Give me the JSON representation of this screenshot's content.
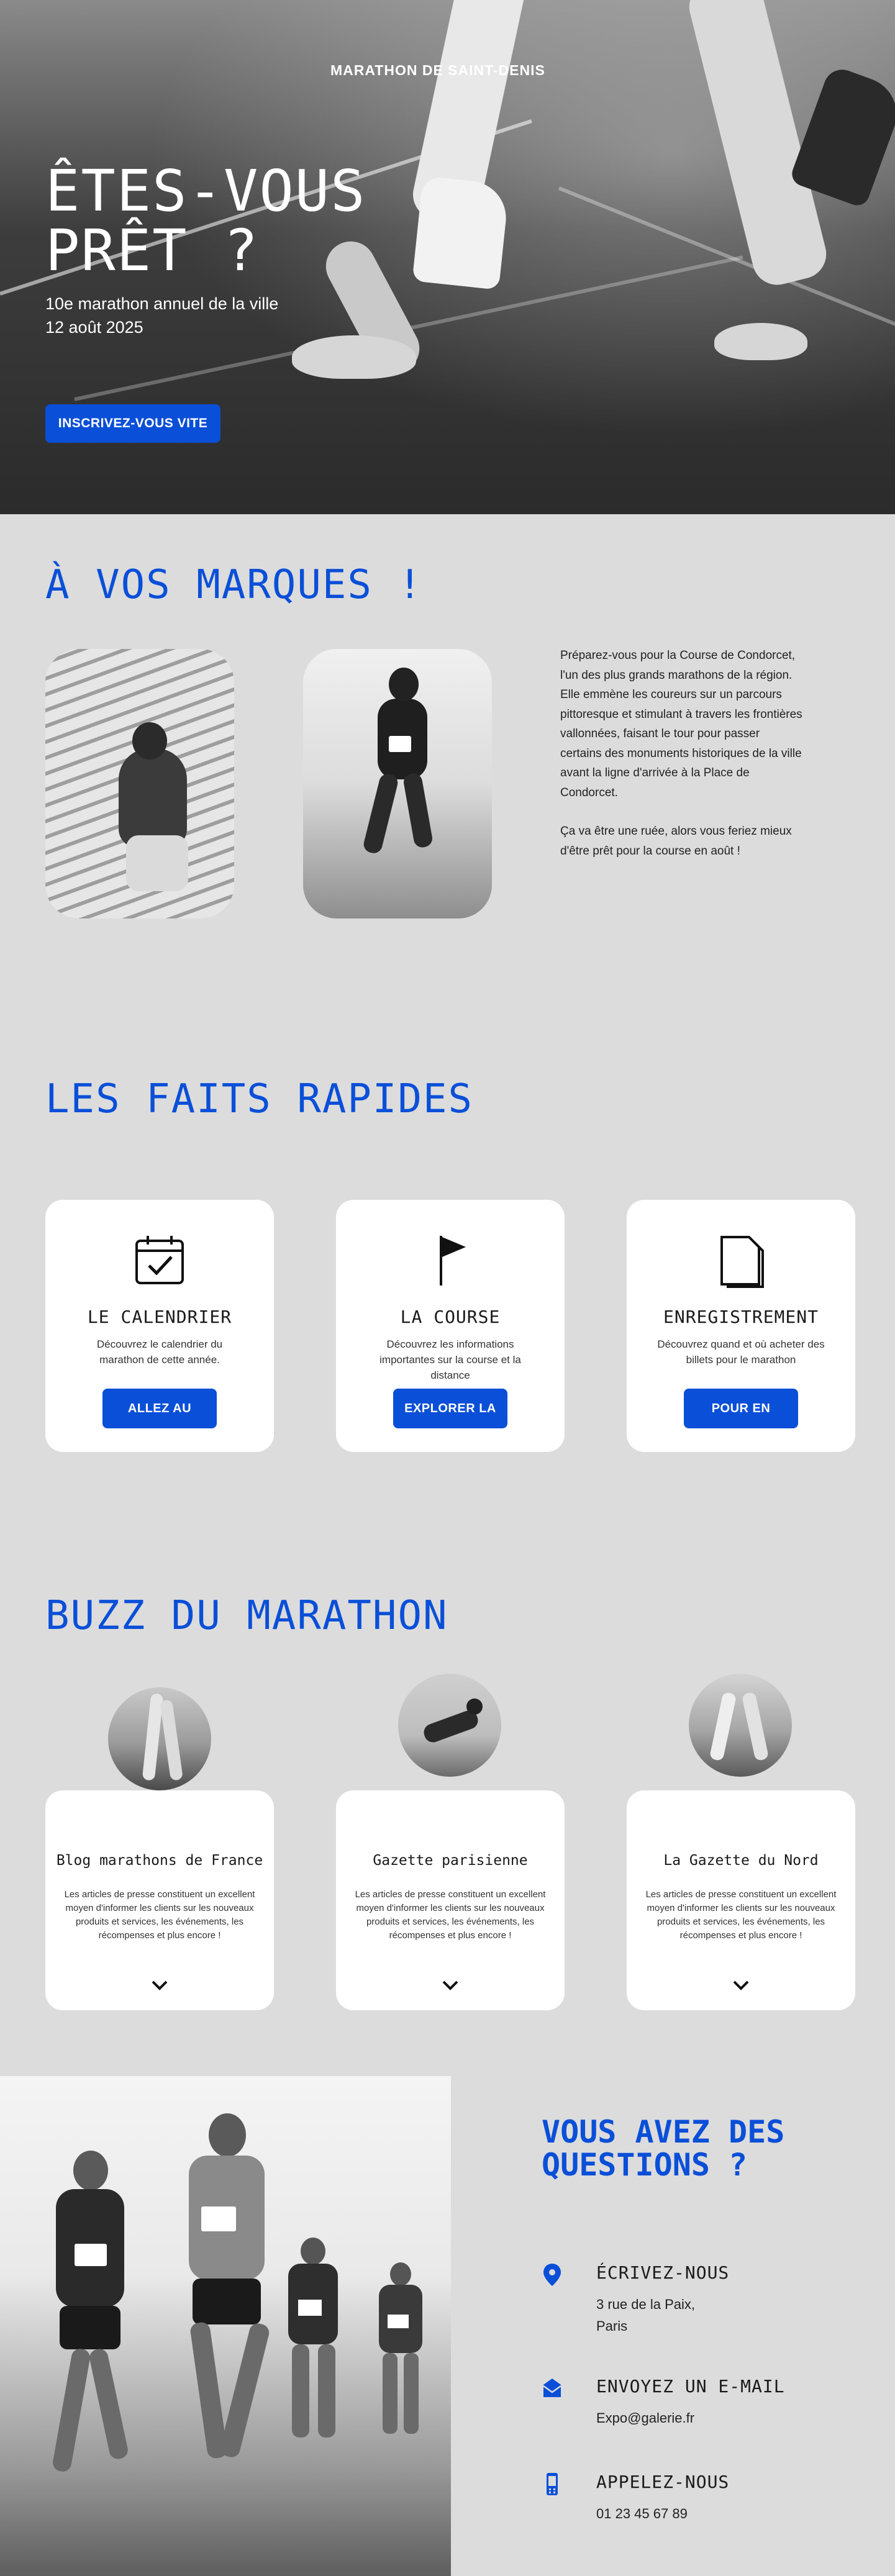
{
  "hero": {
    "brand": "MARATHON DE SAINT-DENIS",
    "title_line1": "ÊTES-VOUS",
    "title_line2": "PRÊT ?",
    "subtitle_line1": "10e marathon annuel de la ville",
    "subtitle_line2": "12 août 2025",
    "cta_label": "INSCRIVEZ-VOUS VITE"
  },
  "intro": {
    "title": "À VOS MARQUES !",
    "paragraph1": "Préparez-vous pour la Course de Condorcet, l'un des plus grands marathons de la région. Elle emmène les coureurs sur un parcours pittoresque et stimulant à travers les frontières vallonnées, faisant le tour pour passer certains des monuments historiques de la ville avant la ligne d'arrivée à la Place de Condorcet.",
    "paragraph2": "Ça va être une ruée, alors vous feriez mieux d'être prêt pour la course en août !"
  },
  "facts": {
    "title": "LES FAITS RAPIDES",
    "cards": [
      {
        "icon": "calendar-icon",
        "title": "LE CALENDRIER",
        "description": "Découvrez le calendrier du marathon de cette année.",
        "button": "ALLEZ AU CALENDRIER"
      },
      {
        "icon": "flag-icon",
        "title": "LA COURSE",
        "description": "Découvrez les informations importantes sur la course et la distance",
        "button": "EXPLORER LA COURSE"
      },
      {
        "icon": "document-icon",
        "title": "ENREGISTREMENT",
        "description": "Découvrez quand et où acheter des billets pour le marathon",
        "button": "POUR EN SAVOIR PLUS"
      }
    ]
  },
  "buzz": {
    "title": "BUZZ DU MARATHON",
    "cards": [
      {
        "title": "Blog marathons de France",
        "description": "Les articles de presse constituent un excellent moyen d'informer les clients sur les nouveaux produits et services, les événements, les récompenses et plus encore !"
      },
      {
        "title": "Gazette parisienne",
        "description": "Les articles de presse constituent un excellent moyen d'informer les clients sur les nouveaux produits et services, les événements, les récompenses et plus encore !"
      },
      {
        "title": "La Gazette du Nord",
        "description": "Les articles de presse constituent un excellent moyen d'informer les clients sur les nouveaux produits et services, les événements, les récompenses et plus encore !"
      }
    ]
  },
  "contact": {
    "title": "VOUS AVEZ DES QUESTIONS ?",
    "write": {
      "icon": "location-pin-icon",
      "heading": "ÉCRIVEZ-NOUS",
      "line1": "3 rue de la Paix,",
      "line2": "Paris"
    },
    "email": {
      "icon": "envelope-icon",
      "heading": "ENVOYEZ UN E-MAIL",
      "value": "Expo@galerie.fr"
    },
    "phone": {
      "icon": "phone-icon",
      "heading": "APPELEZ-NOUS",
      "value": "01 23 45 67 89"
    }
  },
  "colors": {
    "accent": "#0a4fd8",
    "background": "#dcdcdc",
    "card": "#ffffff"
  }
}
